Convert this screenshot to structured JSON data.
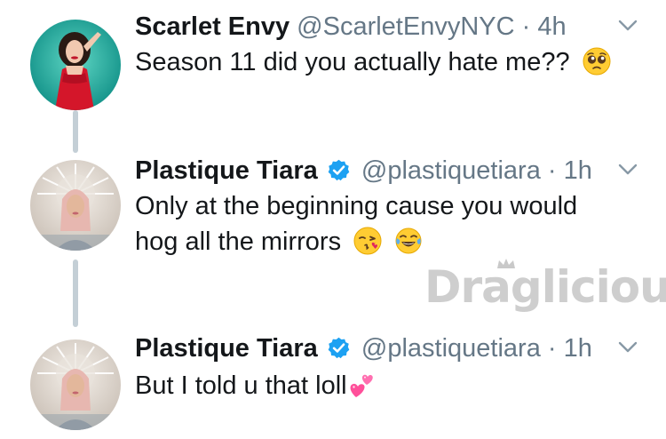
{
  "thread": [
    {
      "display_name": "Scarlet Envy",
      "handle": "@ScarletEnvyNYC",
      "separator": "·",
      "time": "4h",
      "verified": false,
      "lines": [
        "Season 11 did you actually hate me??"
      ],
      "emojis": [
        "pleading-face"
      ],
      "avatar": "avatar-scarlet-envy"
    },
    {
      "display_name": "Plastique Tiara",
      "handle": "@plastiquetiara",
      "separator": "·",
      "time": "1h",
      "verified": true,
      "lines": [
        "Only at the beginning cause you would",
        "hog all the mirrors"
      ],
      "emojis": [
        "kissing-face",
        "tears-of-joy-face"
      ],
      "avatar": "avatar-plastique-tiara"
    },
    {
      "display_name": "Plastique Tiara",
      "handle": "@plastiquetiara",
      "separator": "·",
      "time": "1h",
      "verified": true,
      "lines": [
        "But I told u that loll"
      ],
      "emojis": [
        "two-hearts"
      ],
      "avatar": "avatar-plastique-tiara"
    }
  ],
  "watermark": {
    "text": "Draglicious"
  },
  "colors": {
    "name": "#14171a",
    "secondary": "#657786",
    "verified": "#1da1f2",
    "thread_line": "#c4cfd6"
  }
}
